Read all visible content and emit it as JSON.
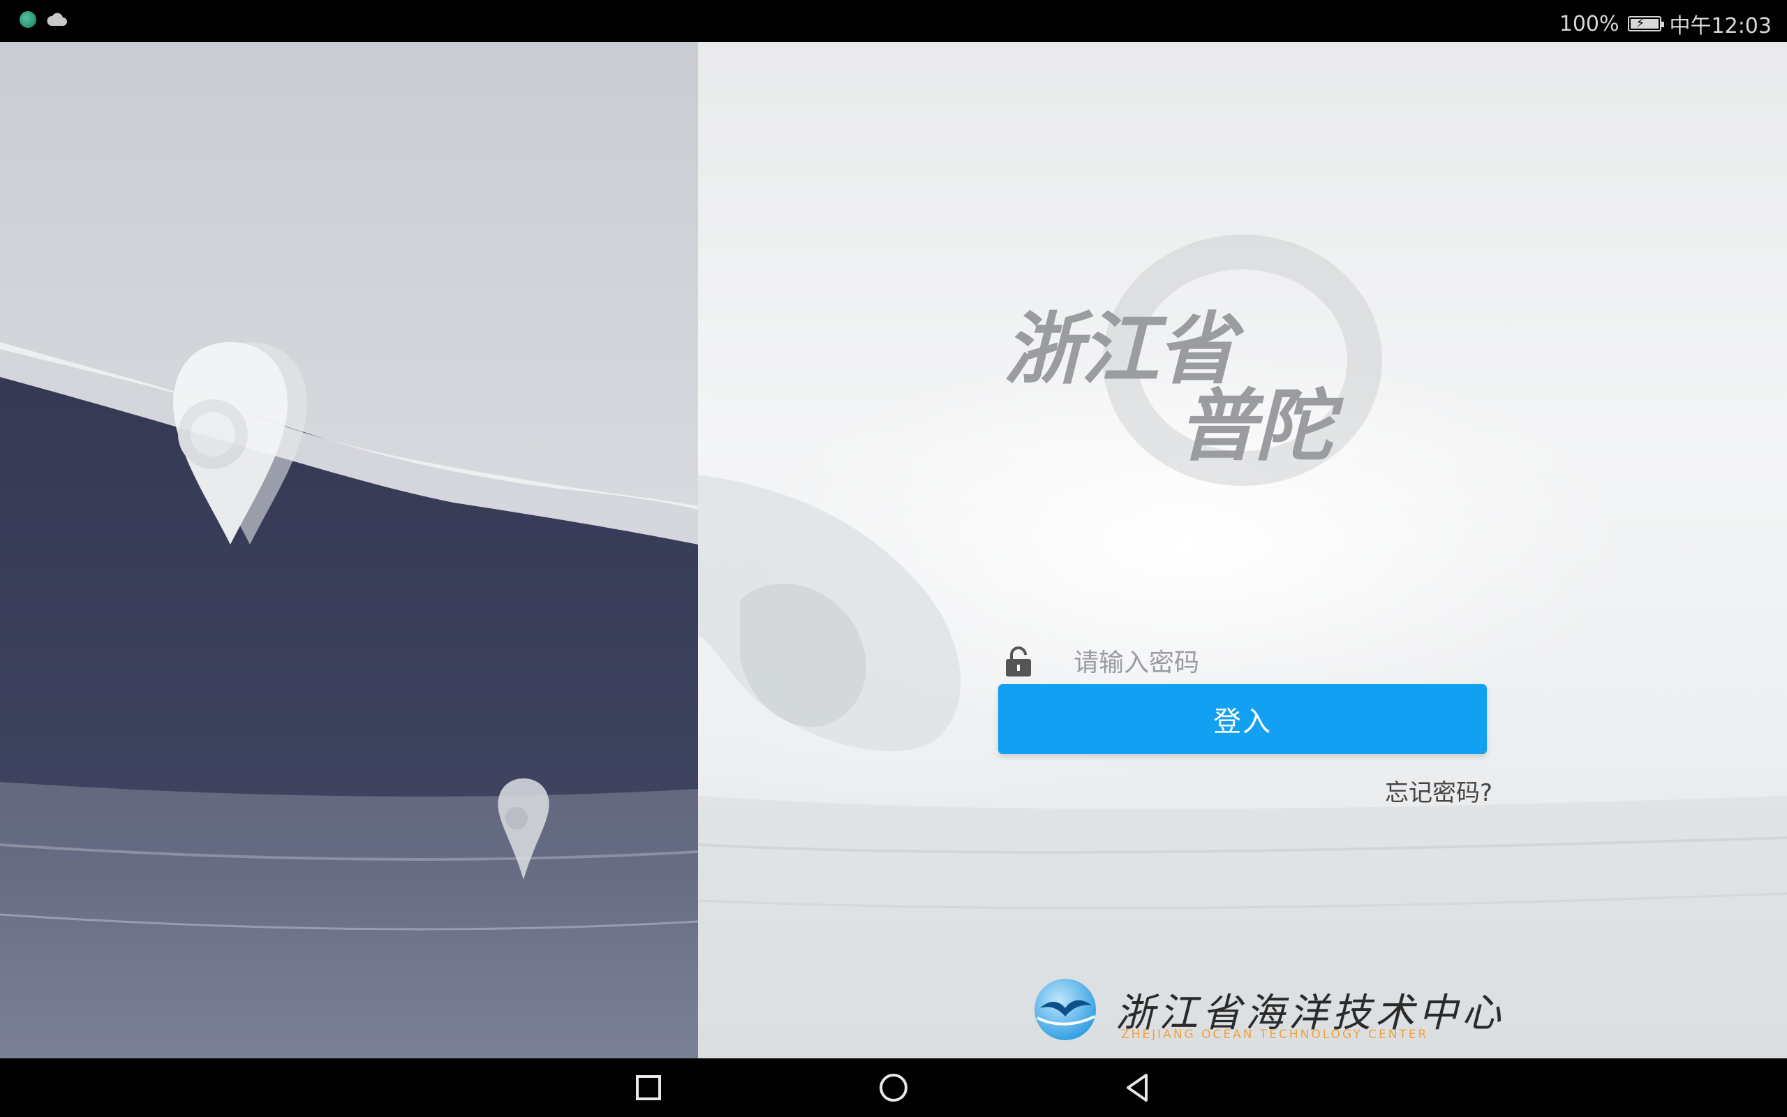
{
  "status_bar": {
    "battery_percent": "100%",
    "time": "中午12:03",
    "icons": [
      "app-status-icon",
      "cloud-icon",
      "battery-charging-icon"
    ]
  },
  "brand": {
    "line1": "浙江省",
    "line2": "普陀"
  },
  "login": {
    "password_placeholder": "请输入密码",
    "password_value": "",
    "login_label": "登入",
    "forgot_label": "忘记密码?"
  },
  "organization": {
    "name_cn": "浙江省海洋技术中心",
    "name_en": "ZHEJIANG OCEAN TECHNOLOGY CENTER"
  },
  "colors": {
    "primary": "#12a0f2",
    "left_panel": "#363a55",
    "text_muted": "#9a9c9f"
  },
  "nav_bar": [
    "recent-apps-icon",
    "home-icon",
    "back-icon"
  ]
}
